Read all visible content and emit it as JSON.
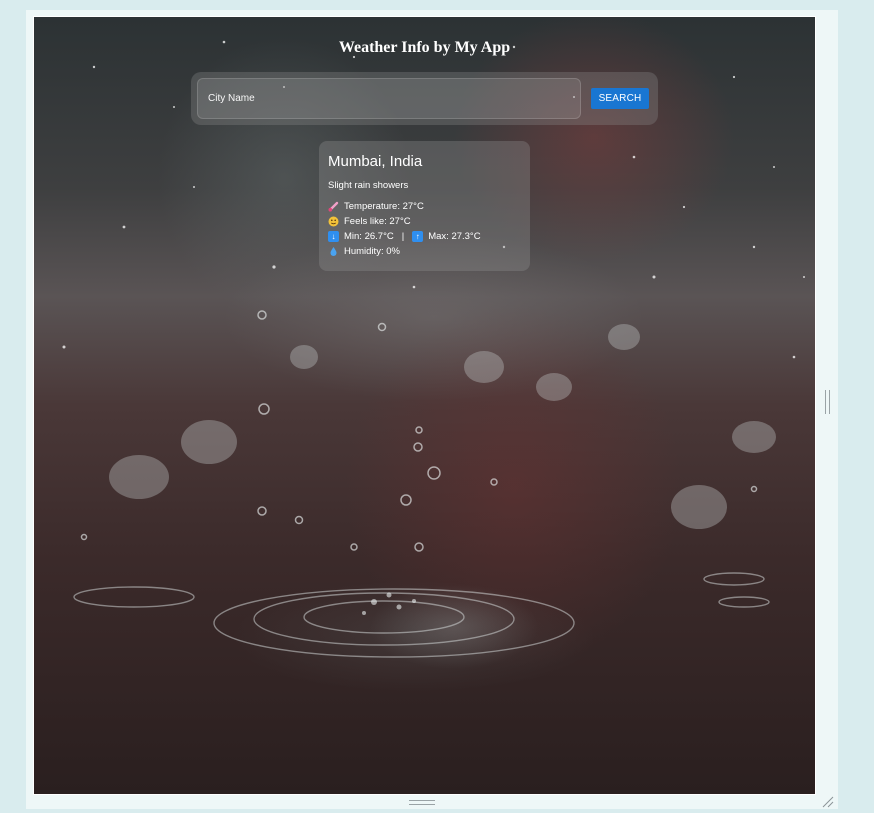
{
  "app": {
    "title": "Weather Info by My App"
  },
  "search": {
    "placeholder": "City Name",
    "value": "",
    "button_label": "SEARCH"
  },
  "weather": {
    "location": "Mumbai, India",
    "description": "Slight rain showers",
    "temperature_text": "Temperature: 27°C",
    "feels_like_text": "Feels like: 27°C",
    "min_text": "Min: 26.7°C",
    "separator": "|",
    "max_text": "Max: 27.3°C",
    "humidity_text": "Humidity: 0%"
  },
  "icons": {
    "temperature": "thermometer-icon",
    "feels_like": "face-icon",
    "min": "down-arrow-icon",
    "max": "up-arrow-icon",
    "humidity": "droplet-icon",
    "accent_color": "#1976d2"
  }
}
